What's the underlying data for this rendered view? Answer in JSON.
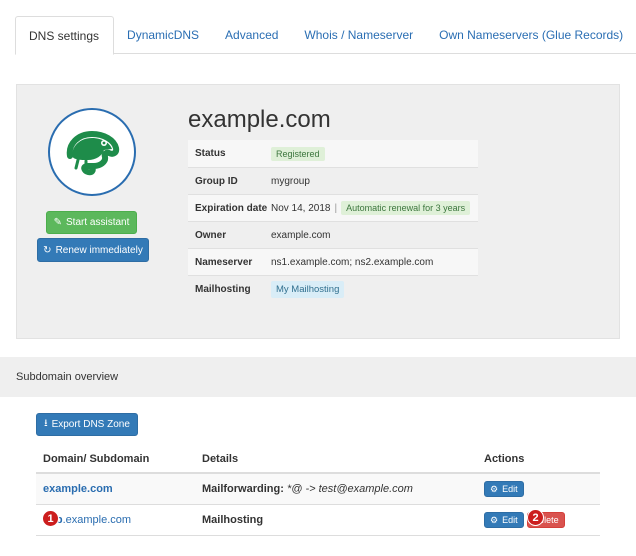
{
  "tabs": [
    {
      "label": "DNS settings",
      "active": true
    },
    {
      "label": "DynamicDNS"
    },
    {
      "label": "Advanced"
    },
    {
      "label": "Whois / Nameserver"
    },
    {
      "label": "Own Nameservers (Glue Records)"
    }
  ],
  "domain": {
    "name": "example.com",
    "logo_icon": "chameleon-logo-icon",
    "start_assistant_label": "Start assistant",
    "renew_label": "Renew immediately",
    "info": {
      "status_key": "Status",
      "status_value": "Registered",
      "group_key": "Group ID",
      "group_value": "mygroup",
      "expiration_key": "Expiration date",
      "expiration_value": "Nov 14, 2018",
      "expiration_sep": "|",
      "renewal_badge": "Automatic renewal for 3 years",
      "owner_key": "Owner",
      "owner_value": "example.com",
      "nameserver_key": "Nameserver",
      "nameserver_value": "ns1.example.com; ns2.example.com",
      "mailhosting_key": "Mailhosting",
      "mailhosting_value": "My Mailhosting"
    }
  },
  "subdomains": {
    "heading": "Subdomain overview",
    "export_label": "Export DNS Zone",
    "columns": [
      "Domain/ Subdomain",
      "Details",
      "Actions"
    ],
    "rows": [
      {
        "domain": "example.com",
        "detail_key": "Mailforwarding:",
        "detail_value": "*@ -> test@example.com",
        "edit_label": "Edit"
      },
      {
        "sub": "sub",
        "domain_rest": ".example.com",
        "detail_key": "Mailhosting",
        "edit_label": "Edit",
        "delete_label": "Delete"
      }
    ],
    "markers": [
      "1",
      "2"
    ]
  },
  "colors": {
    "accent": "#337ab7",
    "success": "#5cb85c",
    "danger": "#d9534f",
    "logo": "#1e8c4a"
  }
}
